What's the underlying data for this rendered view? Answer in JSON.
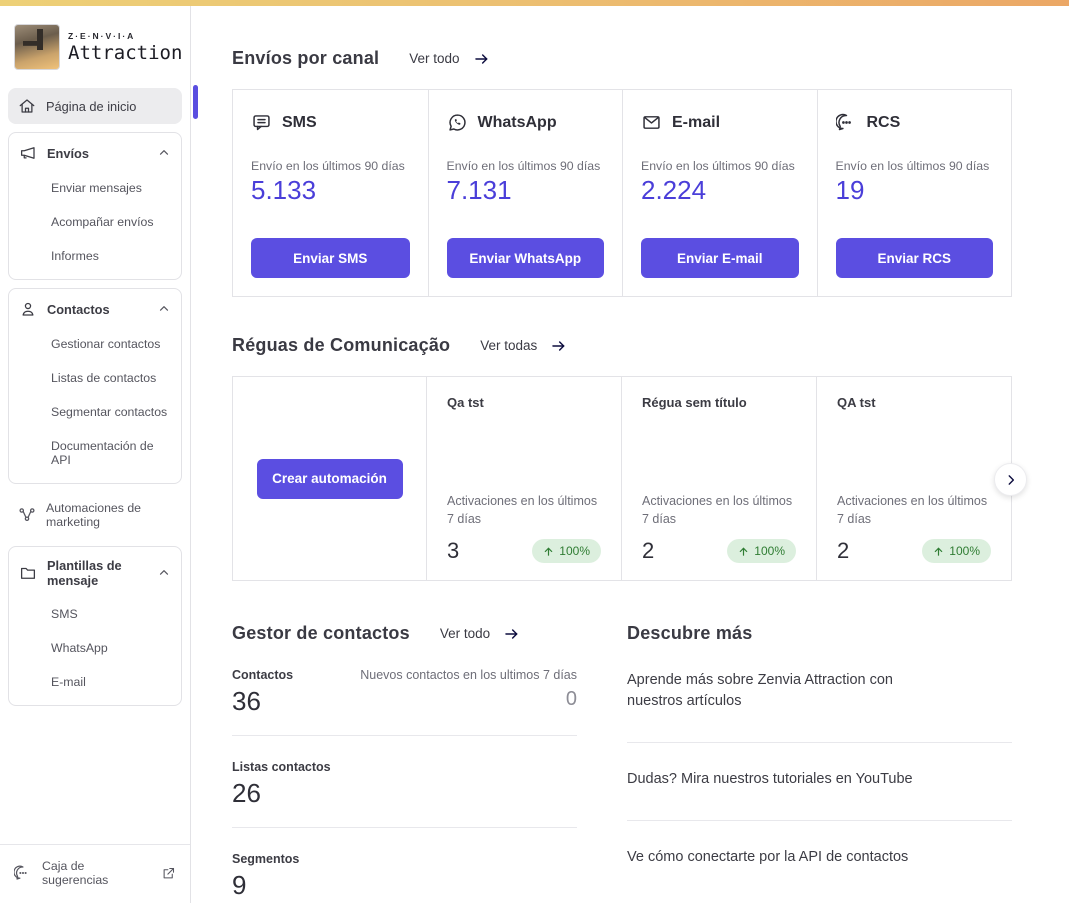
{
  "brand": {
    "name_top": "Z·E·N·V·I·A",
    "name_bottom": "Attraction"
  },
  "sidebar": {
    "home": {
      "label": "Página de inicio",
      "icon": "home-icon"
    },
    "groups": [
      {
        "label": "Envíos",
        "icon": "megaphone-icon",
        "items": [
          "Enviar mensajes",
          "Acompañar envíos",
          "Informes"
        ]
      },
      {
        "label": "Contactos",
        "icon": "person-icon",
        "items": [
          "Gestionar contactos",
          "Listas de contactos",
          "Segmentar contactos",
          "Documentación de API"
        ]
      }
    ],
    "automations": {
      "label": "Automaciones de marketing",
      "icon": "workflow-icon"
    },
    "templates": {
      "label": "Plantillas de mensaje",
      "icon": "folder-icon",
      "items": [
        "SMS",
        "WhatsApp",
        "E-mail"
      ]
    },
    "footer": {
      "label": "Caja de sugerencias",
      "icon": "chat-bubble-icon",
      "action_icon": "external-link-icon"
    }
  },
  "channels": {
    "title": "Envíos por canal",
    "link": "Ver todo",
    "stat_label": "Envío en los últimos 90 días",
    "cards": [
      {
        "name": "SMS",
        "icon": "sms-icon",
        "value": "5.133",
        "button": "Enviar SMS"
      },
      {
        "name": "WhatsApp",
        "icon": "whatsapp-icon",
        "value": "7.131",
        "button": "Enviar WhatsApp"
      },
      {
        "name": "E-mail",
        "icon": "email-icon",
        "value": "2.224",
        "button": "Enviar E-mail"
      },
      {
        "name": "RCS",
        "icon": "rcs-icon",
        "value": "19",
        "button": "Enviar RCS"
      }
    ]
  },
  "rules": {
    "title": "Réguas de Comunicação",
    "link": "Ver todas",
    "create_button": "Crear automación",
    "stat_label": "Activaciones en los últimos 7 días",
    "cards": [
      {
        "name": "Qa tst",
        "value": "3",
        "badge": "100%"
      },
      {
        "name": "Régua sem título",
        "value": "2",
        "badge": "100%"
      },
      {
        "name": "QA tst",
        "value": "2",
        "badge": "100%"
      }
    ]
  },
  "contacts": {
    "title": "Gestor de contactos",
    "link": "Ver todo",
    "rows": [
      {
        "label": "Contactos",
        "value": "36",
        "side_label": "Nuevos contactos en los ultimos 7 días",
        "side_value": "0"
      },
      {
        "label": "Listas contactos",
        "value": "26"
      },
      {
        "label": "Segmentos",
        "value": "9"
      }
    ]
  },
  "discover": {
    "title": "Descubre más",
    "items": [
      "Aprende más sobre Zenvia Attraction con nuestros artículos",
      "Dudas? Mira nuestros tutoriales en YouTube",
      "Ve cómo conectarte por la API de contactos"
    ]
  },
  "colors": {
    "accent": "#5B4EE1",
    "number_purple": "#4A3ED9",
    "badge_bg": "#DCEFDE",
    "badge_text": "#2F7D33",
    "topbar_from": "#EDD077",
    "topbar_to": "#EBA766"
  }
}
